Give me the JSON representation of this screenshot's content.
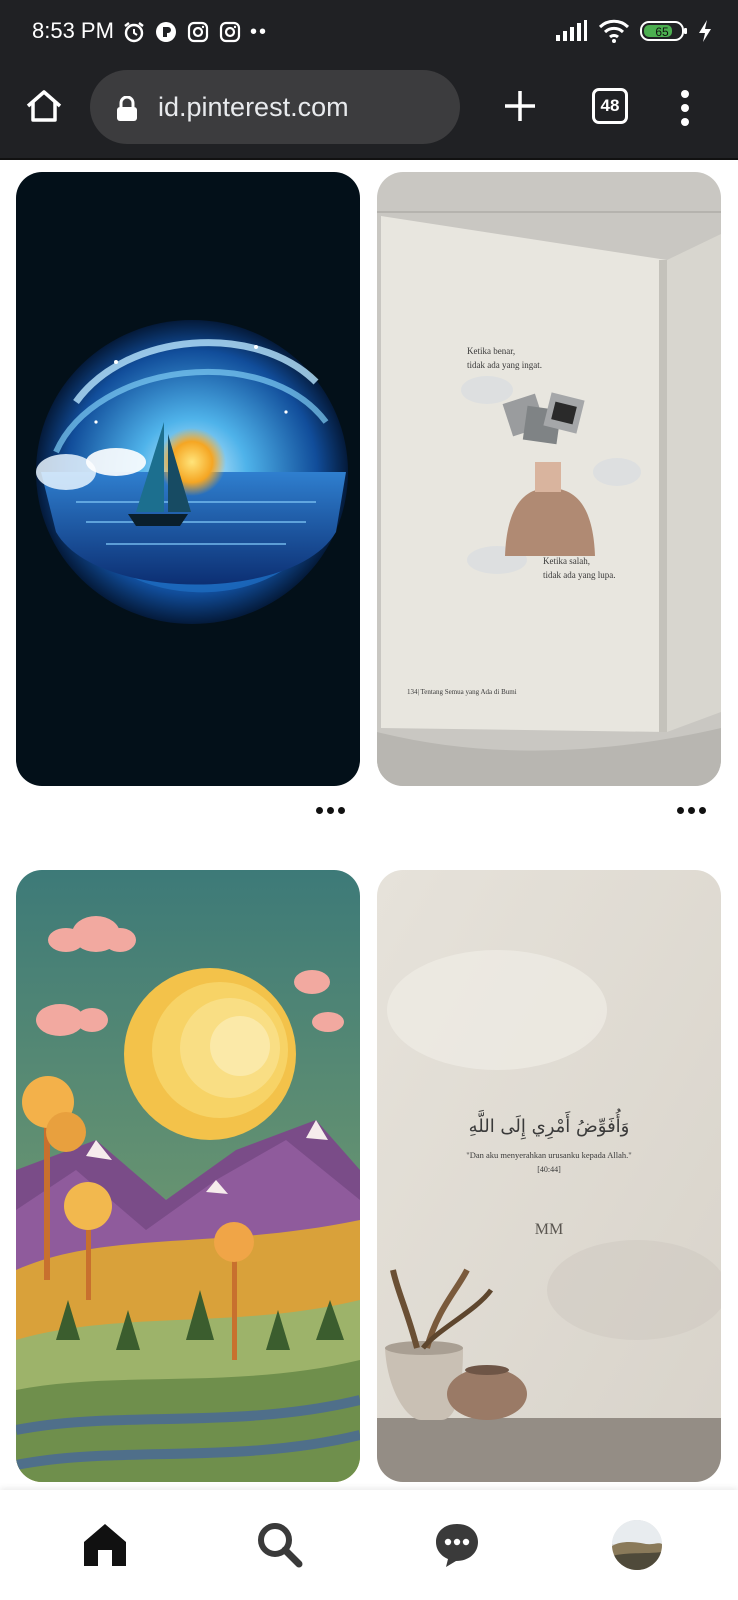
{
  "status_bar": {
    "time": "8:53 PM",
    "left_icons": [
      "alarm-icon",
      "app-icon",
      "instagram-icon",
      "instagram-icon",
      "more-dots"
    ],
    "right_icons": [
      "signal-icon",
      "wifi-icon",
      "battery-icon",
      "charging-icon"
    ],
    "battery": "65"
  },
  "browser": {
    "url": "id.pinterest.com",
    "tab_count": "48"
  },
  "pins": [
    {
      "subject": "night-ocean-swirl-sailboat"
    },
    {
      "subject": "open-book-page",
      "top_text_1": "Ketika benar,",
      "top_text_2": "tidak ada yang ingat.",
      "bottom_text_1": "Ketika salah,",
      "bottom_text_2": "tidak ada yang lupa.",
      "footer": "134| Tentang Semua yang Ada di Bumi"
    },
    {
      "subject": "paper-craft-landscape-sun"
    },
    {
      "subject": "quote-with-vases",
      "arabic": "وَأُفَوِّضُ أَمْرِي إِلَى اللَّهِ",
      "quote": "\"Dan aku menyerahkan urusanku kepada Allah.\"",
      "reference": "[40:44]",
      "monogram": "MM"
    }
  ],
  "bottom_nav": {
    "items": [
      "home-icon",
      "search-icon",
      "messages-icon",
      "profile-avatar"
    ],
    "active": "home"
  },
  "colors": {
    "chrome_dark": "#202124",
    "url_pill": "#3c3c3e",
    "icon_dark": "#111111",
    "battery_green": "#4caf50"
  }
}
